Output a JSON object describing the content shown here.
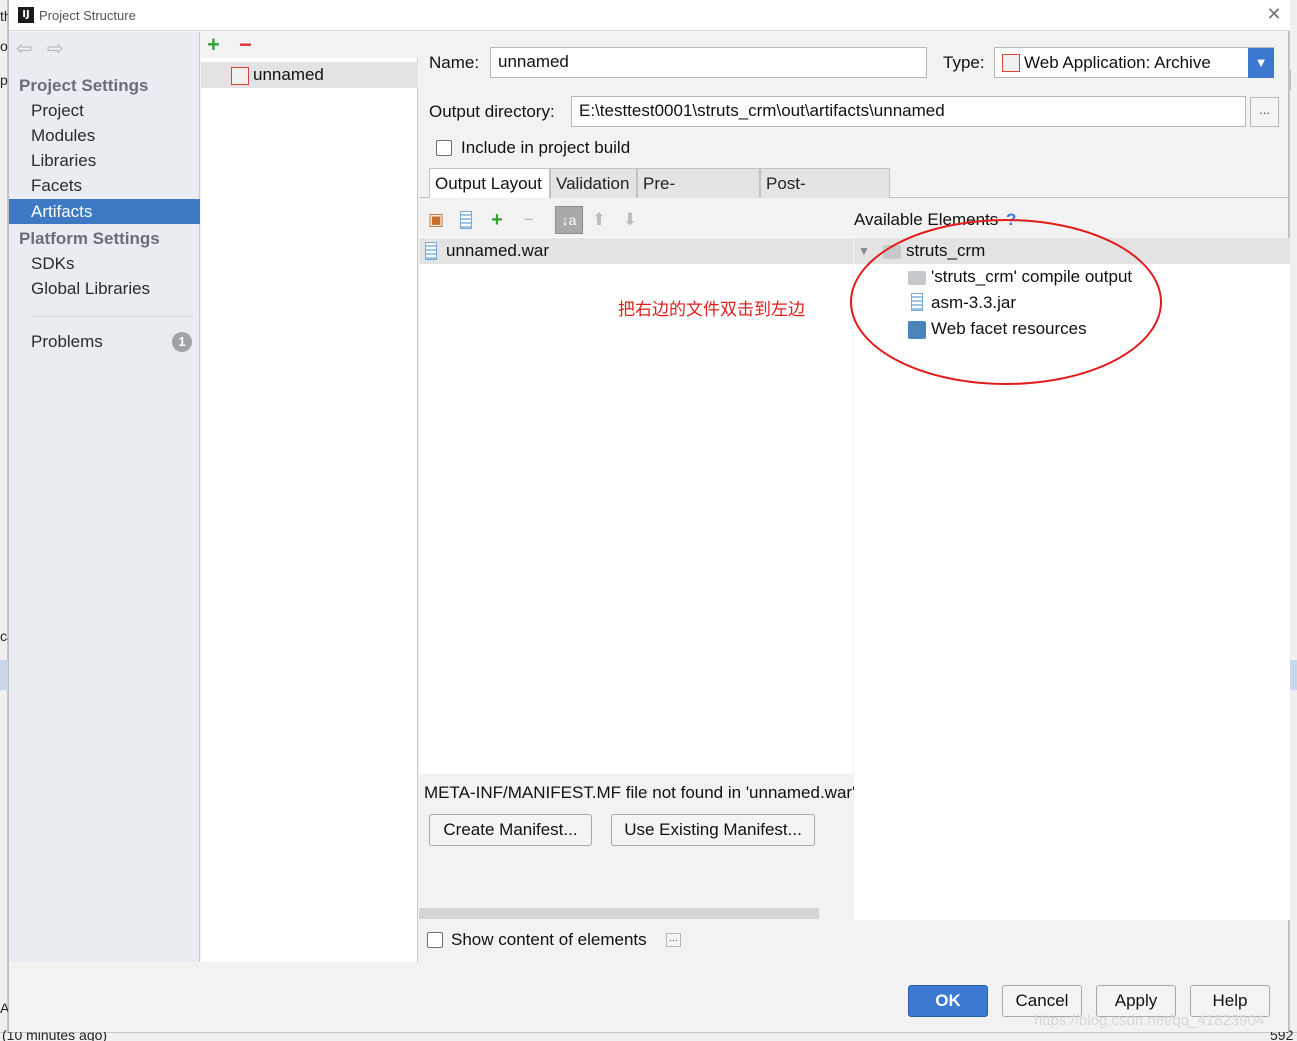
{
  "background": {
    "left_text_1": "th",
    "left_text_2": "or",
    "left_text_3": "p",
    "left_text_4": "ca",
    "left_text_5": "A",
    "bottom_text": "(10 minutes ago)",
    "right_text": "592"
  },
  "window": {
    "title": "Project Structure",
    "app_icon_text": "IJ"
  },
  "sidebar": {
    "project_settings_header": "Project Settings",
    "project_items": [
      "Project",
      "Modules",
      "Libraries",
      "Facets",
      "Artifacts"
    ],
    "selected_item": "Artifacts",
    "platform_settings_header": "Platform Settings",
    "platform_items": [
      "SDKs",
      "Global Libraries"
    ],
    "problems_label": "Problems",
    "problems_count": "1"
  },
  "artifacts": {
    "list": [
      "unnamed"
    ]
  },
  "form": {
    "name_label": "Name:",
    "name_value": "unnamed",
    "type_label": "Type:",
    "type_value": "Web Application: Archive",
    "output_dir_label": "Output directory:",
    "output_dir_value": "E:\\testtest0001\\struts_crm\\out\\artifacts\\unnamed",
    "browse_label": "...",
    "include_build_label": "Include in project build",
    "include_build_checked": false
  },
  "tabs": [
    {
      "label": "Output Layout",
      "active": true
    },
    {
      "label": "Validation",
      "active": false
    },
    {
      "label": "Pre-processing",
      "active": false
    },
    {
      "label": "Post-processing",
      "active": false
    }
  ],
  "output_layout": {
    "root_item": "unnamed.war",
    "annotation": "把右边的文件双击到左边",
    "manifest_message": "META-INF/MANIFEST.MF file not found in 'unnamed.war'",
    "create_manifest_label": "Create Manifest...",
    "use_existing_manifest_label": "Use Existing Manifest...",
    "show_content_label": "Show content of elements",
    "show_content_checked": false
  },
  "available": {
    "title": "Available Elements",
    "help": "?",
    "root": "struts_crm",
    "children": [
      "'struts_crm' compile output",
      "asm-3.3.jar",
      "Web facet resources"
    ]
  },
  "buttons": {
    "ok": "OK",
    "cancel": "Cancel",
    "apply": "Apply",
    "help": "Help"
  },
  "watermark": "https://blog.csdn.net/qq_41823904",
  "colors": {
    "accent": "#3e7ac4",
    "annotation": "#e02020",
    "add": "#2fa336",
    "remove": "#d8363a"
  }
}
